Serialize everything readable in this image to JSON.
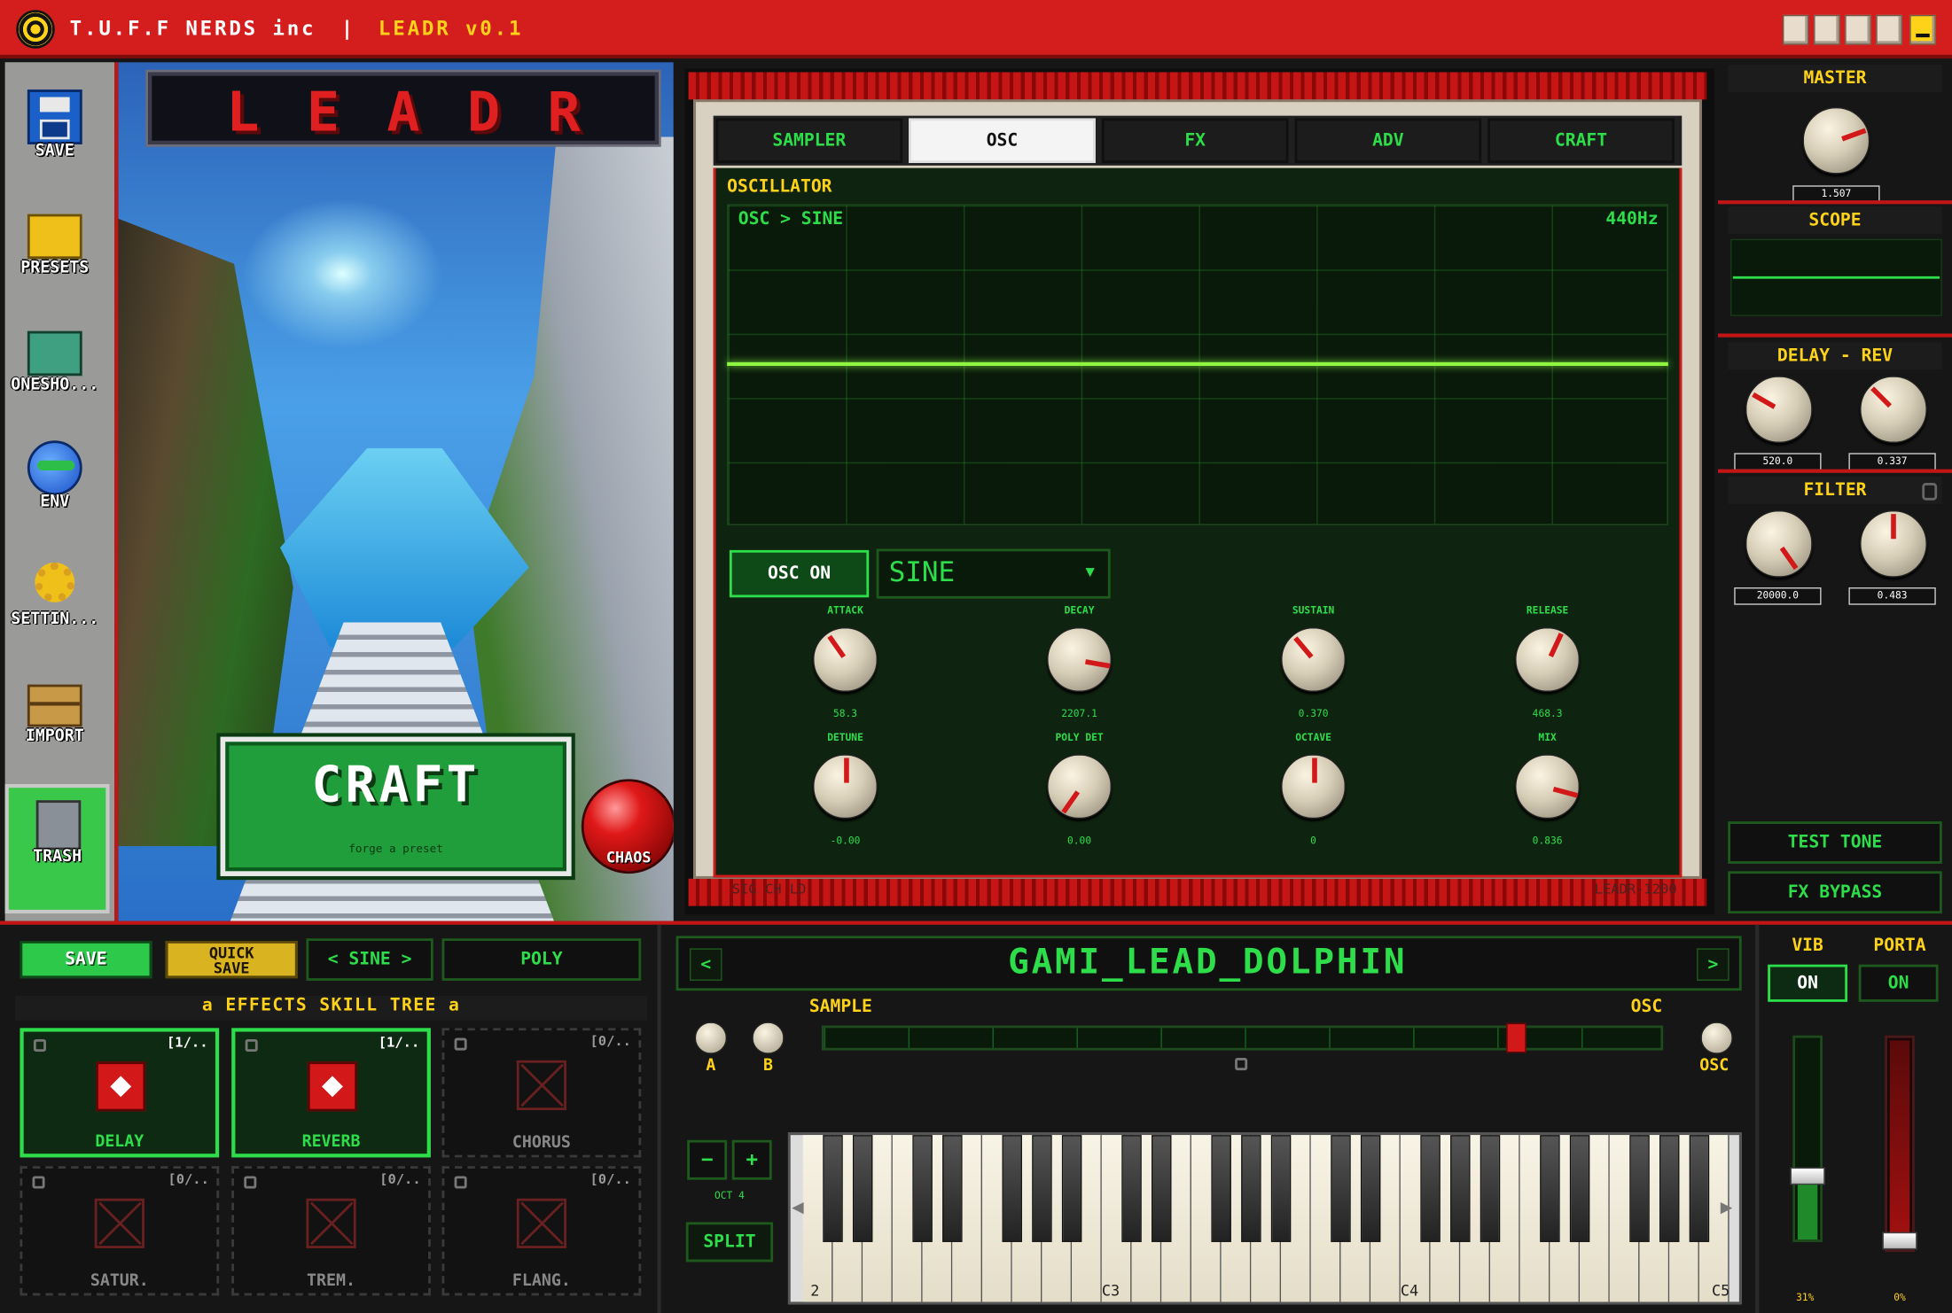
{
  "titlebar": {
    "company": "T.U.F.F NERDS inc",
    "separator": "|",
    "app": "LEADR v0.1"
  },
  "desktop": {
    "icons": [
      {
        "label": "SAVE",
        "icon": "floppy-disk-icon"
      },
      {
        "label": "PRESETS",
        "icon": "folder-icon"
      },
      {
        "label": "ONESHO...",
        "icon": "folder-icon"
      },
      {
        "label": "ENV",
        "icon": "globe-icon"
      },
      {
        "label": "SETTIN...",
        "icon": "gear-icon"
      },
      {
        "label": "IMPORT",
        "icon": "box-icon"
      },
      {
        "label": "TRASH",
        "icon": "trash-icon"
      }
    ]
  },
  "art": {
    "banner": "LEADR",
    "craft_label": "CRAFT",
    "craft_sub": "forge a preset",
    "chaos_label": "CHAOS"
  },
  "tabs": [
    "SAMPLER",
    "OSC",
    "FX",
    "ADV",
    "CRAFT"
  ],
  "active_tab": "OSC",
  "osc": {
    "title": "OSCILLATOR",
    "path": "OSC > SINE",
    "freq": "440Hz",
    "on_label": "OSC ON",
    "waveform": "SINE",
    "knobs": [
      {
        "label": "ATTACK",
        "value": "58.3",
        "angle": -35
      },
      {
        "label": "DECAY",
        "value": "2207.1",
        "angle": 100
      },
      {
        "label": "SUSTAIN",
        "value": "0.370",
        "angle": -40
      },
      {
        "label": "RELEASE",
        "value": "468.3",
        "angle": 25
      },
      {
        "label": "DETUNE",
        "value": "-0.00",
        "angle": 0
      },
      {
        "label": "POLY DET",
        "value": "0.00",
        "angle": -145
      },
      {
        "label": "OCTAVE",
        "value": "0",
        "angle": 0
      },
      {
        "label": "MIX",
        "value": "0.836",
        "angle": 105
      }
    ],
    "status_left": "SIG  CH  LD",
    "status_right": "LEADR-1200"
  },
  "right": {
    "master_label": "MASTER",
    "master_value": "1.507",
    "scope_label": "SCOPE",
    "delay_label": "DELAY - REV",
    "delay_values": [
      "520.0",
      "0.337"
    ],
    "filter_label": "FILTER",
    "filter_values": [
      "20000.0",
      "0.483"
    ],
    "test_tone": "TEST TONE",
    "fx_bypass": "FX BYPASS"
  },
  "bottom": {
    "save": "SAVE",
    "quick_save_1": "QUICK",
    "quick_save_2": "SAVE",
    "wave": "< SINE >",
    "mode": "POLY",
    "skill_tree": "a  EFFECTS SKILL TREE  a",
    "nodes": [
      {
        "name": "DELAY",
        "count": "[1/..",
        "on": true
      },
      {
        "name": "REVERB",
        "count": "[1/..",
        "on": true
      },
      {
        "name": "CHORUS",
        "count": "[0/..",
        "on": false
      },
      {
        "name": "SATUR.",
        "count": "[0/..",
        "on": false
      },
      {
        "name": "TREM.",
        "count": "[0/..",
        "on": false
      },
      {
        "name": "FLANG.",
        "count": "[0/..",
        "on": false
      }
    ],
    "preset_name": "GAMI_LEAD_DOLPHIN",
    "prev": "<",
    "next": ">",
    "sample_label": "SAMPLE",
    "osc_label": "OSC",
    "knob_a": "A",
    "knob_b": "B",
    "knob_osc": "OSC",
    "oct_minus": "−",
    "oct_plus": "+",
    "oct_label": "OCT 4",
    "split": "SPLIT",
    "key_labels": [
      "2",
      "C3",
      "C4",
      "C5"
    ],
    "vib_label": "VIB",
    "vib_state": "ON",
    "vib_value": "31%",
    "porta_label": "PORTA",
    "porta_state": "ON",
    "porta_value": "0%",
    "slider_position": 0.83,
    "vib_level": 0.31,
    "porta_level": 0.0
  },
  "colors": {
    "accent_red": "#d41d1d",
    "accent_green": "#2dde4a",
    "accent_yellow": "#ffd21a"
  }
}
